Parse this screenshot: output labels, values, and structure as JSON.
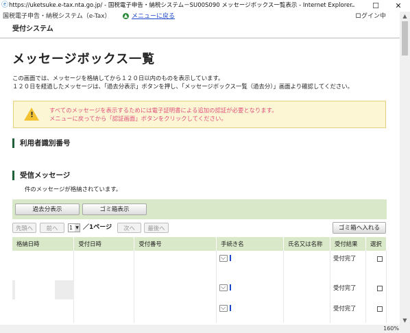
{
  "window": {
    "title": "https://uketsuke.e-tax.nta.go.jp/ - 国税電子申告・納税システム－SU00S090 メッセージボックス一覧表示 - Internet Explorer",
    "minimize": "–",
    "maximize": "☐",
    "close": "✕"
  },
  "nav": {
    "system_name": "国税電子申告・納税システム（e-Tax）",
    "back_link": "メニューに戻る",
    "login_status": "ログイン中"
  },
  "header": {
    "system": "受付システム"
  },
  "page": {
    "title": "メッセージボックス一覧",
    "desc_line1": "この画面では、メッセージを格納してから１２０日以内のものを表示しています。",
    "desc_line2": "１２０日を経過したメッセージは、「過去分表示」ボタンを押し、「メッセージボックス一覧（過去分）」画面より確認してください。"
  },
  "warning": {
    "line1": "すべてのメッセージを表示するためには電子証明書による追加の認証が必要となります。",
    "line2": "メニューに戻ってから「認証画面」ボタンをクリックしてください。"
  },
  "sections": {
    "user_id": "利用者識別番号",
    "received": "受信メッセージ"
  },
  "message_count": "件のメッセージが格納されています。",
  "buttons": {
    "past": "過去分表示",
    "trash_view": "ゴミ箱表示",
    "first": "先頭へ",
    "prev": "前へ",
    "next": "次へ",
    "last": "最後へ",
    "trash_put": "ゴミ箱へ入れる"
  },
  "pager": {
    "selected_page": "1",
    "label": "／1ページ"
  },
  "table": {
    "headers": [
      "格納日時",
      "受付日時",
      "受付番号",
      "手続き名",
      "氏名又は名称",
      "受付結果",
      "選択"
    ],
    "rows": [
      {
        "result": "受付完了"
      },
      {
        "result": "受付完了"
      },
      {
        "result": "受付完了"
      }
    ]
  },
  "status": {
    "zoom": "160%"
  }
}
